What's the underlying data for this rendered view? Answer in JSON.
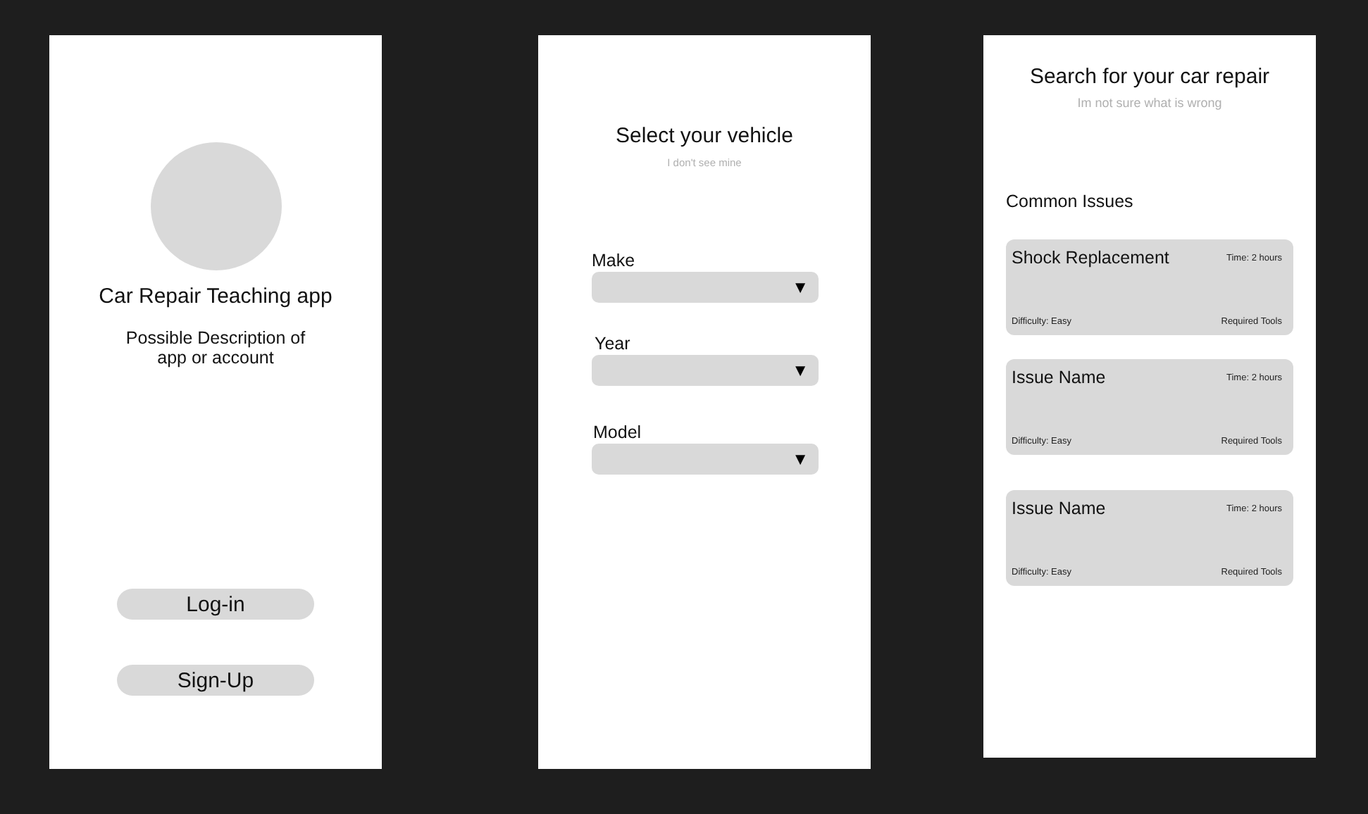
{
  "login_screen": {
    "title": "Car Repair Teaching app",
    "description": "Possible Description of app or account",
    "buttons": [
      "Log-in",
      "Sign-Up"
    ]
  },
  "vehicle_screen": {
    "title": "Select your vehicle",
    "link": "I don't see mine",
    "selects": [
      {
        "label": "Make",
        "arrow": "▼"
      },
      {
        "label": "Year",
        "arrow": "▼"
      },
      {
        "label": "Model",
        "arrow": "▼"
      }
    ]
  },
  "search_screen": {
    "title": "Search for your car repair",
    "link": "Im not sure what is wrong",
    "section": "Common Issues",
    "issues": [
      {
        "name": "Shock Replacement",
        "time": "Time: 2 hours",
        "difficulty": "Difficulty: Easy",
        "tools": "Required Tools"
      },
      {
        "name": "Issue Name",
        "time": "Time: 2 hours",
        "difficulty": "Difficulty: Easy",
        "tools": "Required Tools"
      },
      {
        "name": "Issue Name",
        "time": "Time: 2 hours",
        "difficulty": "Difficulty: Easy",
        "tools": "Required Tools"
      }
    ]
  }
}
